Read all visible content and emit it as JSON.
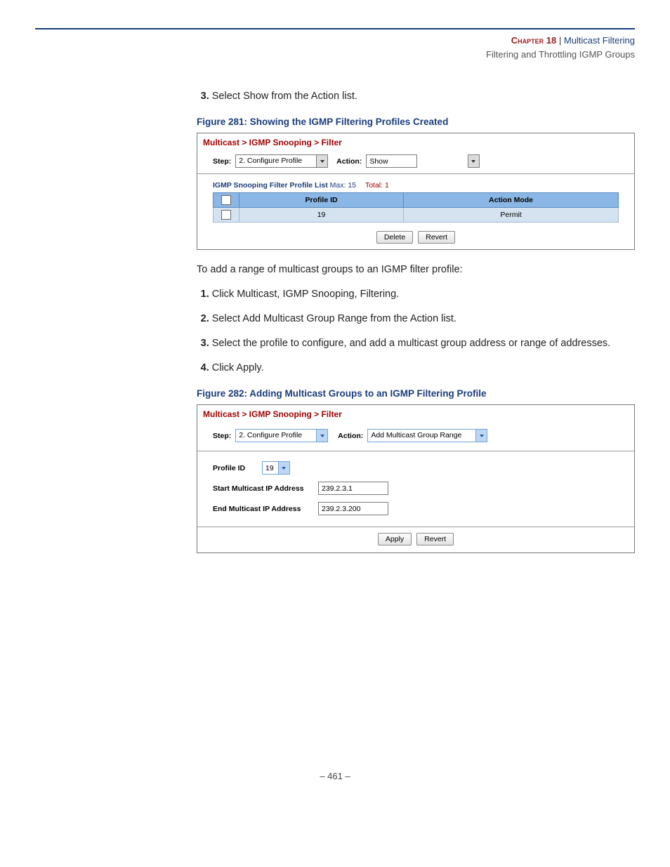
{
  "header": {
    "chapter": "Chapter 18",
    "sep": "  |  ",
    "title": "Multicast Filtering",
    "subtitle": "Filtering and Throttling IGMP Groups"
  },
  "step3_only": {
    "text": "Select Show from the Action list."
  },
  "fig281": {
    "caption": "Figure 281:  Showing the IGMP Filtering Profiles Created",
    "breadcrumb": "Multicast > IGMP Snooping > Filter",
    "step_label": "Step:",
    "step_value": "2. Configure Profile",
    "action_label": "Action:",
    "action_value": "Show",
    "list_label": "IGMP Snooping Filter Profile List",
    "max_label": "Max: 15",
    "total_label": "Total: 1",
    "col1": "Profile ID",
    "col2": "Action Mode",
    "row_profile": "19",
    "row_mode": "Permit",
    "btn_delete": "Delete",
    "btn_revert": "Revert"
  },
  "intro2": "To add a range of multicast groups to an IGMP filter profile:",
  "steps2": {
    "s1": "Click Multicast, IGMP Snooping, Filtering.",
    "s2": "Select Add Multicast Group Range from the Action list.",
    "s3": "Select the profile to configure, and add a multicast group address or range of addresses.",
    "s4": "Click Apply."
  },
  "fig282": {
    "caption": "Figure 282:  Adding Multicast Groups to an IGMP Filtering Profile",
    "breadcrumb": "Multicast > IGMP Snooping > Filter",
    "step_label": "Step:",
    "step_value": "2. Configure Profile",
    "action_label": "Action:",
    "action_value": "Add Multicast Group Range",
    "profile_id_label": "Profile ID",
    "profile_id_value": "19",
    "start_label": "Start Multicast IP Address",
    "start_value": "239.2.3.1",
    "end_label": "End Multicast IP Address",
    "end_value": "239.2.3.200",
    "btn_apply": "Apply",
    "btn_revert": "Revert"
  },
  "footer": "–  461  –"
}
